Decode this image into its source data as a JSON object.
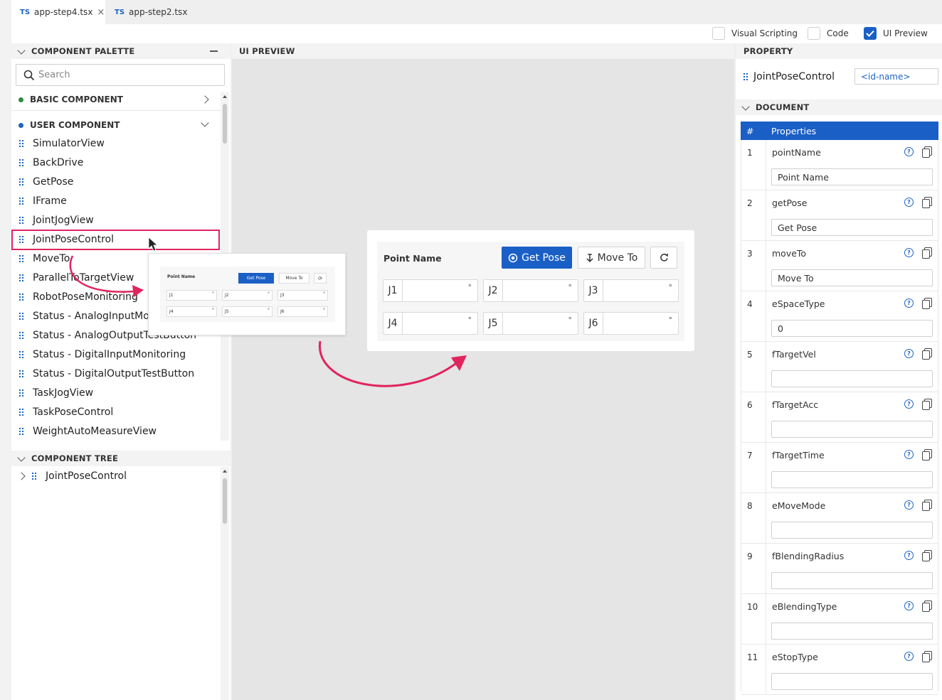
{
  "tabs": [
    {
      "badge": "TS",
      "label": "app-step4.tsx",
      "close": "×"
    },
    {
      "badge": "TS",
      "label": "app-step2.tsx"
    }
  ],
  "view_toggles": [
    {
      "label": "Visual Scripting",
      "checked": false
    },
    {
      "label": "Code",
      "checked": false
    },
    {
      "label": "UI Preview",
      "checked": true
    }
  ],
  "palette": {
    "title": "COMPONENT PALETTE",
    "search_placeholder": "Search",
    "basic_group": "BASIC COMPONENT",
    "user_group": "USER COMPONENT",
    "items": [
      "SimulatorView",
      "BackDrive",
      "GetPose",
      "IFrame",
      "JointJogView",
      "JointPoseControl",
      "MoveTo",
      "ParallelToTargetView",
      "RobotPoseMonitoring",
      "Status - AnalogInputMonitoring",
      "Status - AnalogOutputTestButton",
      "Status - DigitalInputMonitoring",
      "Status - DigitalOutputTestButton",
      "TaskJogView",
      "TaskPoseControl",
      "WeightAutoMeasureView"
    ]
  },
  "tree": {
    "title": "COMPONENT TREE",
    "root": "JointPoseControl"
  },
  "preview": {
    "title": "UI PREVIEW",
    "point_name": "Point Name",
    "get_pose": "Get Pose",
    "move_to": "Move To",
    "joints": [
      "J1",
      "J2",
      "J3",
      "J4",
      "J5",
      "J6"
    ],
    "degree": "°"
  },
  "property": {
    "title": "PROPERTY",
    "component": "JointPoseControl",
    "id_placeholder": "<id-name>",
    "document_title": "DOCUMENT",
    "col_num": "#",
    "col_props": "Properties",
    "rows": [
      {
        "n": "1",
        "name": "pointName",
        "value": "Point Name"
      },
      {
        "n": "2",
        "name": "getPose",
        "value": "Get Pose"
      },
      {
        "n": "3",
        "name": "moveTo",
        "value": "Move To"
      },
      {
        "n": "4",
        "name": "eSpaceType",
        "value": "0"
      },
      {
        "n": "5",
        "name": "fTargetVel",
        "value": ""
      },
      {
        "n": "6",
        "name": "fTargetAcc",
        "value": ""
      },
      {
        "n": "7",
        "name": "fTargetTime",
        "value": ""
      },
      {
        "n": "8",
        "name": "eMoveMode",
        "value": ""
      },
      {
        "n": "9",
        "name": "fBlendingRadius",
        "value": ""
      },
      {
        "n": "10",
        "name": "eBlendingType",
        "value": ""
      },
      {
        "n": "11",
        "name": "eStopType",
        "value": ""
      }
    ]
  },
  "colors": {
    "accent": "#1a5fc6",
    "highlight": "#e0245e",
    "basic_dot": "#2e8b3e",
    "user_dot": "#1d64c4"
  }
}
